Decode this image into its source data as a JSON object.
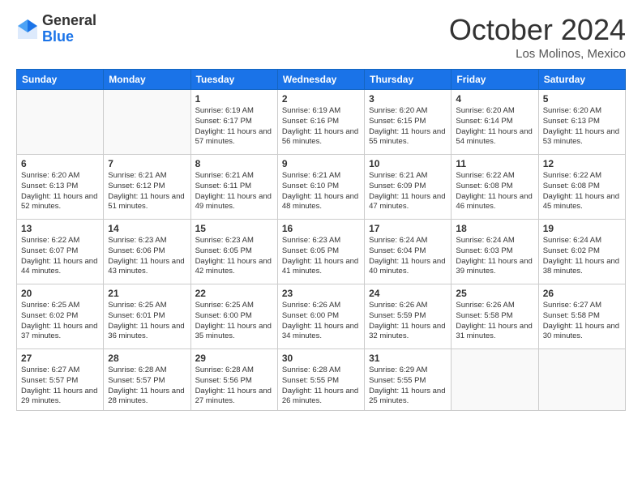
{
  "header": {
    "logo_general": "General",
    "logo_blue": "Blue",
    "month_title": "October 2024",
    "location": "Los Molinos, Mexico"
  },
  "days_of_week": [
    "Sunday",
    "Monday",
    "Tuesday",
    "Wednesday",
    "Thursday",
    "Friday",
    "Saturday"
  ],
  "weeks": [
    [
      {
        "day": "",
        "empty": true
      },
      {
        "day": "",
        "empty": true
      },
      {
        "day": "1",
        "sunrise": "Sunrise: 6:19 AM",
        "sunset": "Sunset: 6:17 PM",
        "daylight": "Daylight: 11 hours and 57 minutes."
      },
      {
        "day": "2",
        "sunrise": "Sunrise: 6:19 AM",
        "sunset": "Sunset: 6:16 PM",
        "daylight": "Daylight: 11 hours and 56 minutes."
      },
      {
        "day": "3",
        "sunrise": "Sunrise: 6:20 AM",
        "sunset": "Sunset: 6:15 PM",
        "daylight": "Daylight: 11 hours and 55 minutes."
      },
      {
        "day": "4",
        "sunrise": "Sunrise: 6:20 AM",
        "sunset": "Sunset: 6:14 PM",
        "daylight": "Daylight: 11 hours and 54 minutes."
      },
      {
        "day": "5",
        "sunrise": "Sunrise: 6:20 AM",
        "sunset": "Sunset: 6:13 PM",
        "daylight": "Daylight: 11 hours and 53 minutes."
      }
    ],
    [
      {
        "day": "6",
        "sunrise": "Sunrise: 6:20 AM",
        "sunset": "Sunset: 6:13 PM",
        "daylight": "Daylight: 11 hours and 52 minutes."
      },
      {
        "day": "7",
        "sunrise": "Sunrise: 6:21 AM",
        "sunset": "Sunset: 6:12 PM",
        "daylight": "Daylight: 11 hours and 51 minutes."
      },
      {
        "day": "8",
        "sunrise": "Sunrise: 6:21 AM",
        "sunset": "Sunset: 6:11 PM",
        "daylight": "Daylight: 11 hours and 49 minutes."
      },
      {
        "day": "9",
        "sunrise": "Sunrise: 6:21 AM",
        "sunset": "Sunset: 6:10 PM",
        "daylight": "Daylight: 11 hours and 48 minutes."
      },
      {
        "day": "10",
        "sunrise": "Sunrise: 6:21 AM",
        "sunset": "Sunset: 6:09 PM",
        "daylight": "Daylight: 11 hours and 47 minutes."
      },
      {
        "day": "11",
        "sunrise": "Sunrise: 6:22 AM",
        "sunset": "Sunset: 6:08 PM",
        "daylight": "Daylight: 11 hours and 46 minutes."
      },
      {
        "day": "12",
        "sunrise": "Sunrise: 6:22 AM",
        "sunset": "Sunset: 6:08 PM",
        "daylight": "Daylight: 11 hours and 45 minutes."
      }
    ],
    [
      {
        "day": "13",
        "sunrise": "Sunrise: 6:22 AM",
        "sunset": "Sunset: 6:07 PM",
        "daylight": "Daylight: 11 hours and 44 minutes."
      },
      {
        "day": "14",
        "sunrise": "Sunrise: 6:23 AM",
        "sunset": "Sunset: 6:06 PM",
        "daylight": "Daylight: 11 hours and 43 minutes."
      },
      {
        "day": "15",
        "sunrise": "Sunrise: 6:23 AM",
        "sunset": "Sunset: 6:05 PM",
        "daylight": "Daylight: 11 hours and 42 minutes."
      },
      {
        "day": "16",
        "sunrise": "Sunrise: 6:23 AM",
        "sunset": "Sunset: 6:05 PM",
        "daylight": "Daylight: 11 hours and 41 minutes."
      },
      {
        "day": "17",
        "sunrise": "Sunrise: 6:24 AM",
        "sunset": "Sunset: 6:04 PM",
        "daylight": "Daylight: 11 hours and 40 minutes."
      },
      {
        "day": "18",
        "sunrise": "Sunrise: 6:24 AM",
        "sunset": "Sunset: 6:03 PM",
        "daylight": "Daylight: 11 hours and 39 minutes."
      },
      {
        "day": "19",
        "sunrise": "Sunrise: 6:24 AM",
        "sunset": "Sunset: 6:02 PM",
        "daylight": "Daylight: 11 hours and 38 minutes."
      }
    ],
    [
      {
        "day": "20",
        "sunrise": "Sunrise: 6:25 AM",
        "sunset": "Sunset: 6:02 PM",
        "daylight": "Daylight: 11 hours and 37 minutes."
      },
      {
        "day": "21",
        "sunrise": "Sunrise: 6:25 AM",
        "sunset": "Sunset: 6:01 PM",
        "daylight": "Daylight: 11 hours and 36 minutes."
      },
      {
        "day": "22",
        "sunrise": "Sunrise: 6:25 AM",
        "sunset": "Sunset: 6:00 PM",
        "daylight": "Daylight: 11 hours and 35 minutes."
      },
      {
        "day": "23",
        "sunrise": "Sunrise: 6:26 AM",
        "sunset": "Sunset: 6:00 PM",
        "daylight": "Daylight: 11 hours and 34 minutes."
      },
      {
        "day": "24",
        "sunrise": "Sunrise: 6:26 AM",
        "sunset": "Sunset: 5:59 PM",
        "daylight": "Daylight: 11 hours and 32 minutes."
      },
      {
        "day": "25",
        "sunrise": "Sunrise: 6:26 AM",
        "sunset": "Sunset: 5:58 PM",
        "daylight": "Daylight: 11 hours and 31 minutes."
      },
      {
        "day": "26",
        "sunrise": "Sunrise: 6:27 AM",
        "sunset": "Sunset: 5:58 PM",
        "daylight": "Daylight: 11 hours and 30 minutes."
      }
    ],
    [
      {
        "day": "27",
        "sunrise": "Sunrise: 6:27 AM",
        "sunset": "Sunset: 5:57 PM",
        "daylight": "Daylight: 11 hours and 29 minutes."
      },
      {
        "day": "28",
        "sunrise": "Sunrise: 6:28 AM",
        "sunset": "Sunset: 5:57 PM",
        "daylight": "Daylight: 11 hours and 28 minutes."
      },
      {
        "day": "29",
        "sunrise": "Sunrise: 6:28 AM",
        "sunset": "Sunset: 5:56 PM",
        "daylight": "Daylight: 11 hours and 27 minutes."
      },
      {
        "day": "30",
        "sunrise": "Sunrise: 6:28 AM",
        "sunset": "Sunset: 5:55 PM",
        "daylight": "Daylight: 11 hours and 26 minutes."
      },
      {
        "day": "31",
        "sunrise": "Sunrise: 6:29 AM",
        "sunset": "Sunset: 5:55 PM",
        "daylight": "Daylight: 11 hours and 25 minutes."
      },
      {
        "day": "",
        "empty": true
      },
      {
        "day": "",
        "empty": true
      }
    ]
  ]
}
